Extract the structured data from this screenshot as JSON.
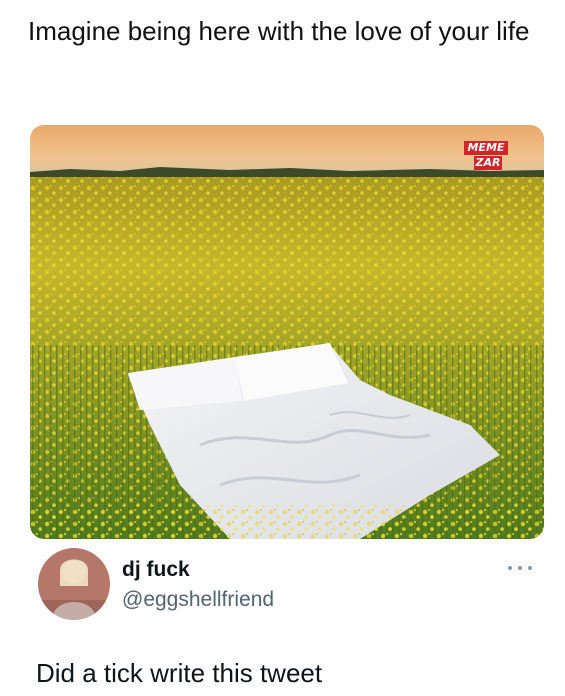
{
  "post": {
    "caption": "Imagine being here with the love of your life",
    "image": {
      "description_icon": "photo-bed-in-flower-field",
      "watermark_line1": "MEME",
      "watermark_line2": "ZAR"
    }
  },
  "tweet": {
    "display_name": "dj fuck",
    "handle": "@eggshellfriend",
    "text": "Did a tick write this tweet",
    "more_icon": "more-dots-icon"
  },
  "colors": {
    "watermark_red": "#d4242b",
    "handle_gray": "#536471",
    "sky_top": "#f2b476",
    "field_yellow": "#c9b21a"
  }
}
